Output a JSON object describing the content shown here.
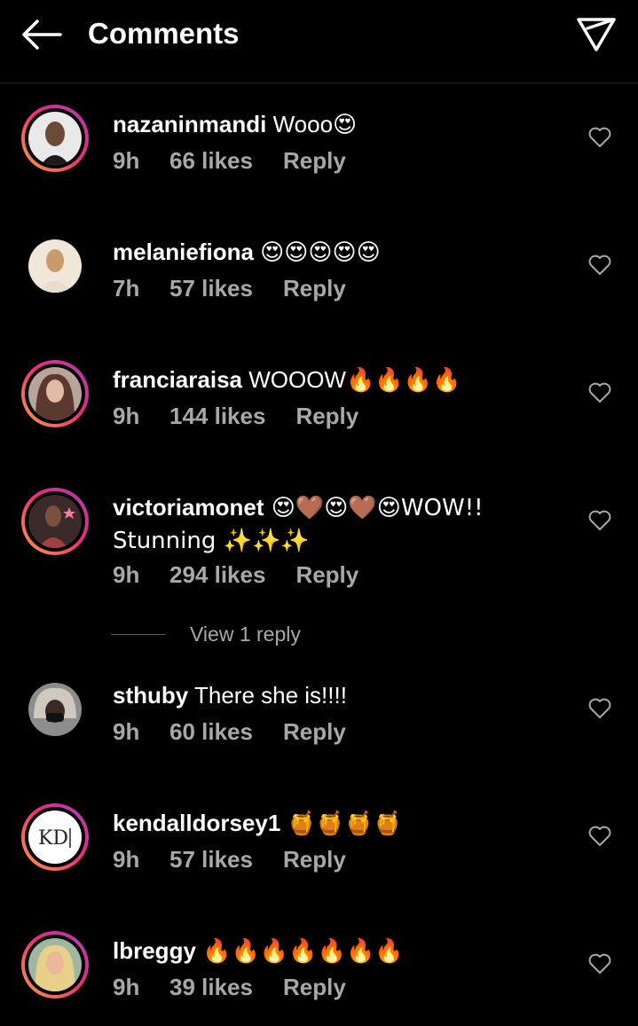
{
  "header": {
    "back_icon": "back-arrow-icon",
    "title": "Comments",
    "share_icon": "send-icon"
  },
  "colors": {
    "background": "#000000",
    "text": "#ffffff",
    "meta": "#a8a8a8",
    "story_ring": "#ee2a7b"
  },
  "comments": [
    {
      "username": "nazaninmandi",
      "text": " Wooo",
      "emoji": "😍",
      "time": "9h",
      "likes": "66 likes",
      "reply": "Reply"
    },
    {
      "username": "melaniefiona",
      "text": " ",
      "emoji": "😍😍😍😍😍",
      "time": "7h",
      "likes": "57 likes",
      "reply": "Reply"
    },
    {
      "username": "franciaraisa",
      "text": " WOOOW",
      "emoji": "🔥🔥🔥🔥",
      "time": "9h",
      "likes": "144 likes",
      "reply": "Reply"
    },
    {
      "username": "victoriamonet",
      "text": " 😍🤎😍🤎😍WOW!! Stunning ✨✨✨",
      "emoji": "",
      "time": "9h",
      "likes": "294 likes",
      "reply": "Reply"
    },
    {
      "username": "sthuby",
      "text": " There she is!!!!",
      "emoji": "",
      "time": "9h",
      "likes": "60 likes",
      "reply": "Reply"
    },
    {
      "username": "kendalldorsey1",
      "text": " ",
      "emoji": "🍯🍯🍯🍯",
      "time": "9h",
      "likes": "57 likes",
      "reply": "Reply"
    },
    {
      "username": "lbreggy",
      "text": " ",
      "emoji": "🔥🔥🔥🔥🔥🔥🔥",
      "time": "9h",
      "likes": "39 likes",
      "reply": "Reply"
    }
  ],
  "view_replies": "View 1 reply",
  "avatar_5_text": "KD"
}
